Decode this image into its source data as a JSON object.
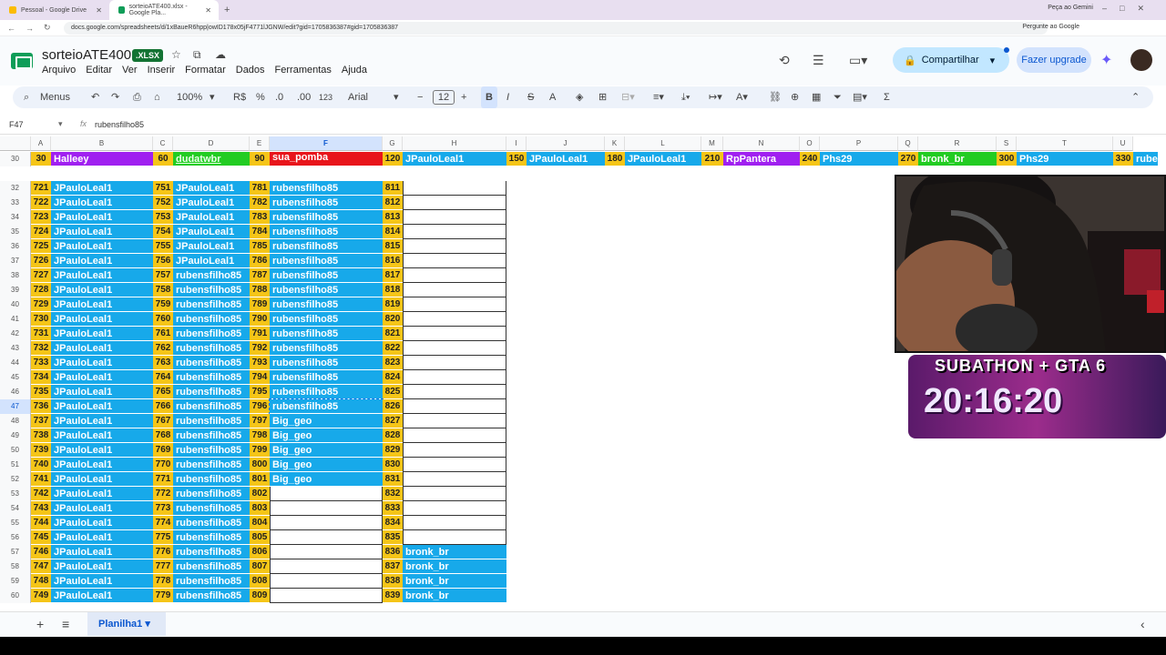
{
  "browser": {
    "tabs": [
      {
        "label": "Pessoal - Google Drive"
      },
      {
        "label": "sorteioATE400.xlsx - Google Pla..."
      }
    ],
    "gemini": "Peça ao Gemini",
    "url": "docs.google.com/spreadsheets/d/1xBaueR6hpp|owID178x05jF4771lJGNW/edit?gid=1705836387#gid=1705836387",
    "ask_google": "Pergunte ao Google"
  },
  "app": {
    "title": "sorteioATE400",
    "badge": ".XLSX",
    "menus": [
      "Arquivo",
      "Editar",
      "Ver",
      "Inserir",
      "Formatar",
      "Dados",
      "Ferramentas",
      "Ajuda"
    ],
    "share": "Compartilhar",
    "upgrade": "Fazer upgrade"
  },
  "toolbar": {
    "menus": "Menus",
    "zoom": "100%",
    "currency": "R$",
    "percent": "%",
    "dec_dec": ".0",
    "inc_dec": ".00",
    "number_format": "123",
    "font": "Arial",
    "font_size": "12",
    "bold": "B",
    "italic": "I",
    "strike": "S",
    "text_color": "A",
    "sum": "Σ"
  },
  "formula_bar": {
    "name_box": "F47",
    "fx": "fx",
    "value": "rubensfilho85"
  },
  "columns": [
    "A",
    "B",
    "C",
    "D",
    "E",
    "F",
    "G",
    "H",
    "I",
    "J",
    "K",
    "L",
    "M",
    "N",
    "O",
    "P",
    "Q",
    "R",
    "S",
    "T",
    "U"
  ],
  "row30": [
    {
      "n": "30",
      "name": "Halleey"
    },
    {
      "n": "60",
      "name": "dudatwbr"
    },
    {
      "n": "90",
      "name": "sua_pomba"
    },
    {
      "n": "120",
      "name": "JPauloLeal1"
    },
    {
      "n": "150",
      "name": "JPauloLeal1"
    },
    {
      "n": "180",
      "name": "JPauloLeal1"
    },
    {
      "n": "210",
      "name": "RpPantera"
    },
    {
      "n": "240",
      "name": "Phs29"
    },
    {
      "n": "270",
      "name": "bronk_br"
    },
    {
      "n": "300",
      "name": "Phs29"
    },
    {
      "n": "330",
      "name": "rube"
    }
  ],
  "rows": [
    {
      "r": "32",
      "a": "721",
      "b": "JPauloLeal1",
      "c": "751",
      "d": "JPauloLeal1",
      "e": "781",
      "f": "rubensfilho85",
      "g": "811",
      "h": ""
    },
    {
      "r": "33",
      "a": "722",
      "b": "JPauloLeal1",
      "c": "752",
      "d": "JPauloLeal1",
      "e": "782",
      "f": "rubensfilho85",
      "g": "812",
      "h": ""
    },
    {
      "r": "34",
      "a": "723",
      "b": "JPauloLeal1",
      "c": "753",
      "d": "JPauloLeal1",
      "e": "783",
      "f": "rubensfilho85",
      "g": "813",
      "h": ""
    },
    {
      "r": "35",
      "a": "724",
      "b": "JPauloLeal1",
      "c": "754",
      "d": "JPauloLeal1",
      "e": "784",
      "f": "rubensfilho85",
      "g": "814",
      "h": ""
    },
    {
      "r": "36",
      "a": "725",
      "b": "JPauloLeal1",
      "c": "755",
      "d": "JPauloLeal1",
      "e": "785",
      "f": "rubensfilho85",
      "g": "815",
      "h": ""
    },
    {
      "r": "37",
      "a": "726",
      "b": "JPauloLeal1",
      "c": "756",
      "d": "JPauloLeal1",
      "e": "786",
      "f": "rubensfilho85",
      "g": "816",
      "h": ""
    },
    {
      "r": "38",
      "a": "727",
      "b": "JPauloLeal1",
      "c": "757",
      "d": "rubensfilho85",
      "e": "787",
      "f": "rubensfilho85",
      "g": "817",
      "h": ""
    },
    {
      "r": "39",
      "a": "728",
      "b": "JPauloLeal1",
      "c": "758",
      "d": "rubensfilho85",
      "e": "788",
      "f": "rubensfilho85",
      "g": "818",
      "h": ""
    },
    {
      "r": "40",
      "a": "729",
      "b": "JPauloLeal1",
      "c": "759",
      "d": "rubensfilho85",
      "e": "789",
      "f": "rubensfilho85",
      "g": "819",
      "h": ""
    },
    {
      "r": "41",
      "a": "730",
      "b": "JPauloLeal1",
      "c": "760",
      "d": "rubensfilho85",
      "e": "790",
      "f": "rubensfilho85",
      "g": "820",
      "h": ""
    },
    {
      "r": "42",
      "a": "731",
      "b": "JPauloLeal1",
      "c": "761",
      "d": "rubensfilho85",
      "e": "791",
      "f": "rubensfilho85",
      "g": "821",
      "h": ""
    },
    {
      "r": "43",
      "a": "732",
      "b": "JPauloLeal1",
      "c": "762",
      "d": "rubensfilho85",
      "e": "792",
      "f": "rubensfilho85",
      "g": "822",
      "h": ""
    },
    {
      "r": "44",
      "a": "733",
      "b": "JPauloLeal1",
      "c": "763",
      "d": "rubensfilho85",
      "e": "793",
      "f": "rubensfilho85",
      "g": "823",
      "h": ""
    },
    {
      "r": "45",
      "a": "734",
      "b": "JPauloLeal1",
      "c": "764",
      "d": "rubensfilho85",
      "e": "794",
      "f": "rubensfilho85",
      "g": "824",
      "h": ""
    },
    {
      "r": "46",
      "a": "735",
      "b": "JPauloLeal1",
      "c": "765",
      "d": "rubensfilho85",
      "e": "795",
      "f": "rubensfilho85",
      "g": "825",
      "h": ""
    },
    {
      "r": "47",
      "a": "736",
      "b": "JPauloLeal1",
      "c": "766",
      "d": "rubensfilho85",
      "e": "796",
      "f": "rubensfilho85",
      "g": "826",
      "h": ""
    },
    {
      "r": "48",
      "a": "737",
      "b": "JPauloLeal1",
      "c": "767",
      "d": "rubensfilho85",
      "e": "797",
      "f": "Big_geo",
      "g": "827",
      "h": ""
    },
    {
      "r": "49",
      "a": "738",
      "b": "JPauloLeal1",
      "c": "768",
      "d": "rubensfilho85",
      "e": "798",
      "f": "Big_geo",
      "g": "828",
      "h": ""
    },
    {
      "r": "50",
      "a": "739",
      "b": "JPauloLeal1",
      "c": "769",
      "d": "rubensfilho85",
      "e": "799",
      "f": "Big_geo",
      "g": "829",
      "h": ""
    },
    {
      "r": "51",
      "a": "740",
      "b": "JPauloLeal1",
      "c": "770",
      "d": "rubensfilho85",
      "e": "800",
      "f": "Big_geo",
      "g": "830",
      "h": ""
    },
    {
      "r": "52",
      "a": "741",
      "b": "JPauloLeal1",
      "c": "771",
      "d": "rubensfilho85",
      "e": "801",
      "f": "Big_geo",
      "g": "831",
      "h": ""
    },
    {
      "r": "53",
      "a": "742",
      "b": "JPauloLeal1",
      "c": "772",
      "d": "rubensfilho85",
      "e": "802",
      "f": "",
      "g": "832",
      "h": ""
    },
    {
      "r": "54",
      "a": "743",
      "b": "JPauloLeal1",
      "c": "773",
      "d": "rubensfilho85",
      "e": "803",
      "f": "",
      "g": "833",
      "h": ""
    },
    {
      "r": "55",
      "a": "744",
      "b": "JPauloLeal1",
      "c": "774",
      "d": "rubensfilho85",
      "e": "804",
      "f": "",
      "g": "834",
      "h": ""
    },
    {
      "r": "56",
      "a": "745",
      "b": "JPauloLeal1",
      "c": "775",
      "d": "rubensfilho85",
      "e": "805",
      "f": "",
      "g": "835",
      "h": ""
    },
    {
      "r": "57",
      "a": "746",
      "b": "JPauloLeal1",
      "c": "776",
      "d": "rubensfilho85",
      "e": "806",
      "f": "",
      "g": "836",
      "h": "bronk_br"
    },
    {
      "r": "58",
      "a": "747",
      "b": "JPauloLeal1",
      "c": "777",
      "d": "rubensfilho85",
      "e": "807",
      "f": "",
      "g": "837",
      "h": "bronk_br"
    },
    {
      "r": "59",
      "a": "748",
      "b": "JPauloLeal1",
      "c": "778",
      "d": "rubensfilho85",
      "e": "808",
      "f": "",
      "g": "838",
      "h": "bronk_br"
    },
    {
      "r": "60",
      "a": "749",
      "b": "JPauloLeal1",
      "c": "779",
      "d": "rubensfilho85",
      "e": "809",
      "f": "",
      "g": "839",
      "h": "bronk_br"
    }
  ],
  "overlay": {
    "subathon": "SUBATHON + GTA 6",
    "timer": "20:16:20"
  },
  "sheet_tab": "Planilha1"
}
